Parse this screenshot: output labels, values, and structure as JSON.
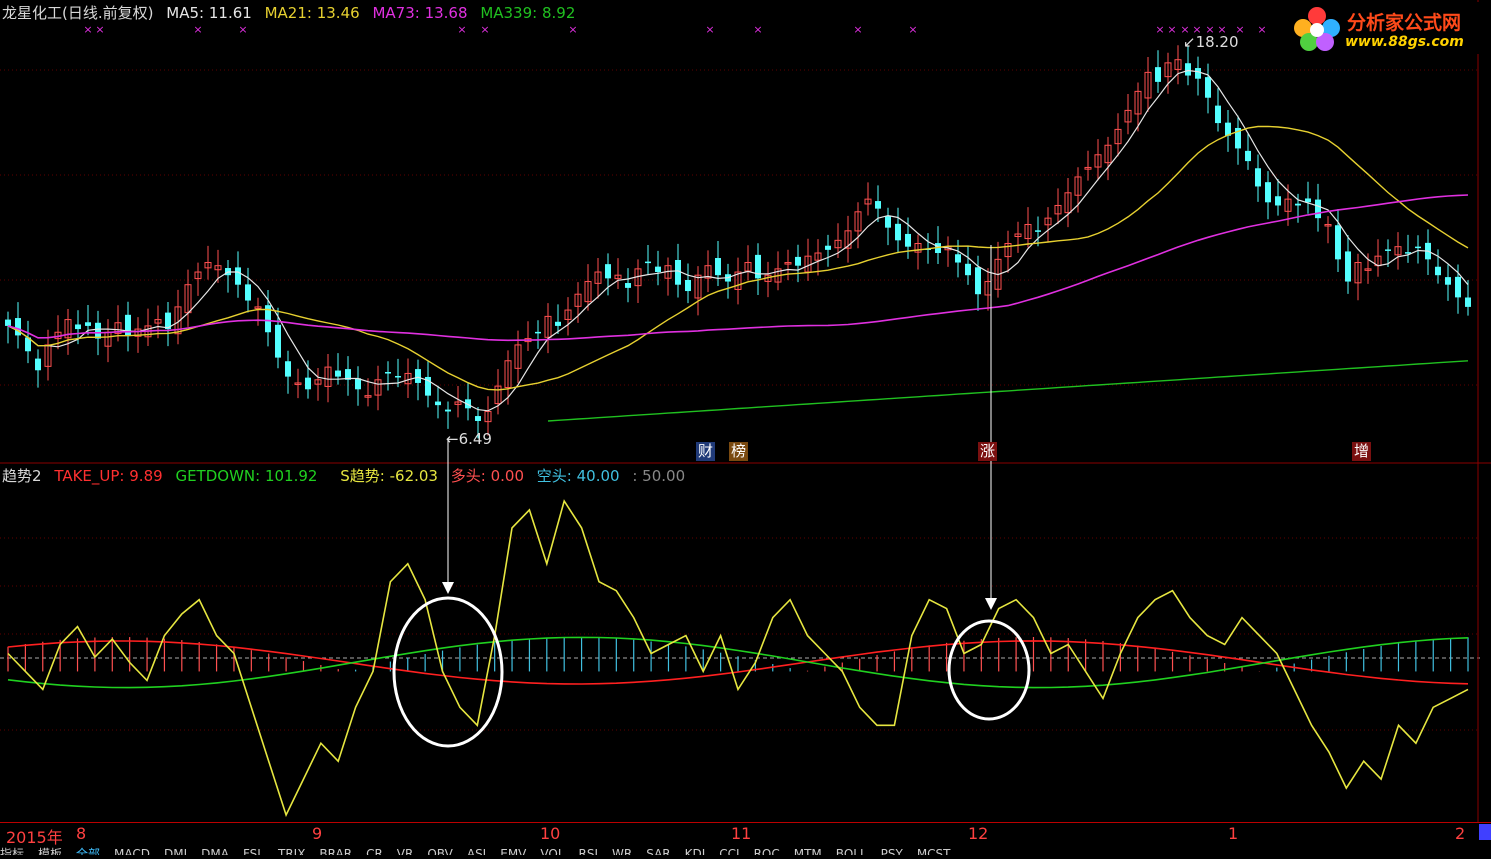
{
  "header": {
    "title": "龙星化工(日线.前复权)",
    "ma5_label": "MA5:",
    "ma5_value": "11.61",
    "ma21_label": "MA21:",
    "ma21_value": "13.46",
    "ma73_label": "MA73:",
    "ma73_value": "13.68",
    "ma339_label": "MA339:",
    "ma339_value": "8.92"
  },
  "logo": {
    "name": "分析家公式网",
    "url": "www.88gs.com"
  },
  "price_annotations": {
    "high": "18.20",
    "low": "6.49"
  },
  "event_tags": [
    {
      "text": "财",
      "color": "#4a7ac8"
    },
    {
      "text": "榜",
      "color": "#c87820"
    },
    {
      "text": "涨",
      "color": "#c02020"
    },
    {
      "text": "增",
      "color": "#c02020"
    }
  ],
  "indicator_header": {
    "name": "趋势2",
    "take_up_label": "TAKE_UP:",
    "take_up_value": "9.89",
    "getdown_label": "GETDOWN:",
    "getdown_value": "101.92",
    "strend_label": "S趋势:",
    "strend_value": "-62.03",
    "long_label": "多头:",
    "long_value": "0.00",
    "short_label": "空头:",
    "short_value": "40.00",
    "level_value": ": 50.00"
  },
  "time_axis": {
    "year": "2015年",
    "labels": [
      "8",
      "9",
      "10",
      "11",
      "12",
      "1",
      "2"
    ]
  },
  "bottom_tabs": [
    "指标",
    "模板",
    "全部",
    "MACD",
    "DMI",
    "DMA",
    "FSL",
    "TRIX",
    "BRAR",
    "CR",
    "VR",
    "OBV",
    "ASI",
    "EMV",
    "VOL",
    "RSI",
    "WR",
    "SAR",
    "KDJ",
    "CCI",
    "ROC",
    "MTM",
    "BOLL",
    "PSY",
    "MCST"
  ],
  "colors": {
    "ma5": "#e6e6e6",
    "ma21": "#e6d030",
    "ma73": "#e030e0",
    "ma339": "#20c020",
    "up_candle": "#ff5050",
    "down_candle": "#54ffff",
    "take_up": "#ff2020",
    "getdown": "#20d020",
    "strend": "#e6e640",
    "long": "#ff5050",
    "short": "#40c0e0"
  },
  "chart_data": [
    {
      "type": "candlestick",
      "title": "龙星化工(日线.前复权)",
      "x_period": "2015-07 to 2016-02 (daily)",
      "ylim": [
        6.0,
        19.0
      ],
      "closes": [
        9.6,
        9.3,
        8.8,
        8.2,
        9.0,
        9.4,
        9.8,
        9.5,
        9.6,
        9.2,
        9.4,
        9.7,
        9.3,
        9.5,
        9.6,
        9.8,
        9.5,
        10.2,
        10.9,
        11.3,
        11.6,
        11.5,
        11.2,
        10.9,
        10.4,
        10.2,
        9.4,
        8.6,
        8.0,
        7.8,
        7.6,
        7.9,
        8.3,
        8.0,
        7.9,
        7.6,
        7.4,
        7.9,
        8.1,
        8.0,
        8.1,
        7.8,
        7.4,
        7.1,
        6.9,
        7.2,
        7.0,
        6.6,
        6.9,
        7.7,
        8.5,
        9.0,
        9.2,
        9.4,
        9.9,
        9.6,
        10.1,
        10.6,
        11.0,
        11.3,
        11.1,
        11.2,
        10.8,
        11.4,
        11.6,
        11.3,
        11.5,
        10.9,
        10.7,
        11.2,
        11.5,
        11.2,
        11.0,
        11.3,
        11.6,
        11.1,
        11.2,
        11.4,
        11.6,
        11.5,
        11.8,
        11.9,
        12.0,
        12.3,
        12.6,
        13.2,
        13.6,
        13.3,
        12.7,
        12.3,
        12.1,
        12.2,
        12.0,
        11.9,
        12.1,
        11.6,
        11.2,
        10.6,
        11.0,
        11.7,
        12.2,
        12.5,
        12.8,
        12.6,
        13.0,
        13.4,
        13.8,
        14.3,
        14.6,
        15.0,
        15.3,
        15.8,
        16.4,
        17.0,
        17.6,
        17.3,
        17.9,
        18.0,
        17.5,
        17.4,
        16.8,
        16.0,
        15.6,
        15.2,
        14.8,
        14.0,
        13.5,
        13.4,
        13.6,
        13.4,
        13.5,
        13.0,
        12.8,
        11.7,
        11.0,
        11.6,
        11.4,
        11.8,
        12.0,
        12.1,
        11.9,
        12.1,
        11.7,
        11.2,
        10.9,
        10.5,
        10.2
      ]
    },
    {
      "type": "line",
      "title": "趋势2",
      "ylim": [
        -40,
        140
      ],
      "series_names": [
        "TAKE_UP",
        "GETDOWN",
        "S趋势"
      ],
      "strend_values": [
        50,
        40,
        30,
        55,
        65,
        48,
        58,
        45,
        35,
        60,
        72,
        80,
        60,
        50,
        20,
        -10,
        -40,
        -20,
        0,
        -10,
        20,
        40,
        90,
        100,
        80,
        40,
        20,
        10,
        60,
        120,
        130,
        100,
        135,
        120,
        90,
        85,
        70,
        50,
        55,
        60,
        40,
        60,
        30,
        45,
        70,
        80,
        60,
        50,
        40,
        20,
        10,
        10,
        60,
        80,
        75,
        50,
        55,
        75,
        80,
        70,
        50,
        55,
        40,
        25,
        50,
        70,
        80,
        85,
        70,
        60,
        55,
        70,
        60,
        50,
        30,
        10,
        -5,
        -25,
        -10,
        -20,
        10,
        0,
        20,
        25,
        30
      ]
    }
  ]
}
